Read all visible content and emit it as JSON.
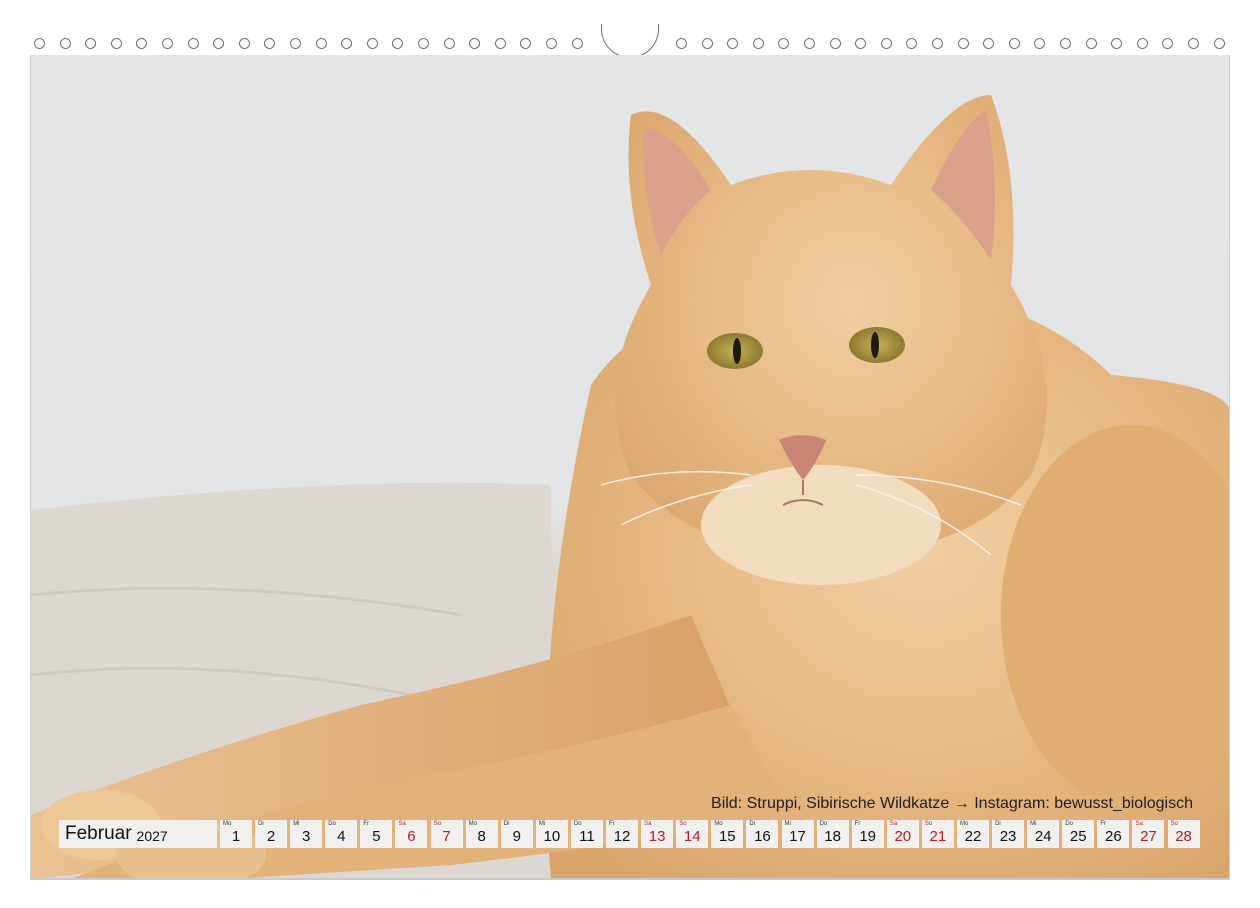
{
  "calendar": {
    "month": "Februar",
    "year": "2027",
    "days": [
      {
        "wd": "Mo",
        "d": "1",
        "weekend": false
      },
      {
        "wd": "Di",
        "d": "2",
        "weekend": false
      },
      {
        "wd": "Mi",
        "d": "3",
        "weekend": false
      },
      {
        "wd": "Do",
        "d": "4",
        "weekend": false
      },
      {
        "wd": "Fr",
        "d": "5",
        "weekend": false
      },
      {
        "wd": "Sa",
        "d": "6",
        "weekend": true
      },
      {
        "wd": "So",
        "d": "7",
        "weekend": true
      },
      {
        "wd": "Mo",
        "d": "8",
        "weekend": false
      },
      {
        "wd": "Di",
        "d": "9",
        "weekend": false
      },
      {
        "wd": "Mi",
        "d": "10",
        "weekend": false
      },
      {
        "wd": "Do",
        "d": "11",
        "weekend": false
      },
      {
        "wd": "Fr",
        "d": "12",
        "weekend": false
      },
      {
        "wd": "Sa",
        "d": "13",
        "weekend": true
      },
      {
        "wd": "So",
        "d": "14",
        "weekend": true
      },
      {
        "wd": "Mo",
        "d": "15",
        "weekend": false
      },
      {
        "wd": "Di",
        "d": "16",
        "weekend": false
      },
      {
        "wd": "Mi",
        "d": "17",
        "weekend": false
      },
      {
        "wd": "Do",
        "d": "18",
        "weekend": false
      },
      {
        "wd": "Fr",
        "d": "19",
        "weekend": false
      },
      {
        "wd": "Sa",
        "d": "20",
        "weekend": true
      },
      {
        "wd": "So",
        "d": "21",
        "weekend": true
      },
      {
        "wd": "Mo",
        "d": "22",
        "weekend": false
      },
      {
        "wd": "Di",
        "d": "23",
        "weekend": false
      },
      {
        "wd": "Mi",
        "d": "24",
        "weekend": false
      },
      {
        "wd": "Do",
        "d": "25",
        "weekend": false
      },
      {
        "wd": "Fr",
        "d": "26",
        "weekend": false
      },
      {
        "wd": "Sa",
        "d": "27",
        "weekend": true
      },
      {
        "wd": "So",
        "d": "28",
        "weekend": true
      }
    ]
  },
  "caption": "Bild: Struppi, Sibirische Wildkatze → Instagram: bewusst_biologisch",
  "colors": {
    "weekend": "#b21d1d",
    "cell_background": "#f2f0ee",
    "fur": "#e6b886",
    "wall": "#e3e4e6",
    "blanket": "#d8d3cc"
  }
}
